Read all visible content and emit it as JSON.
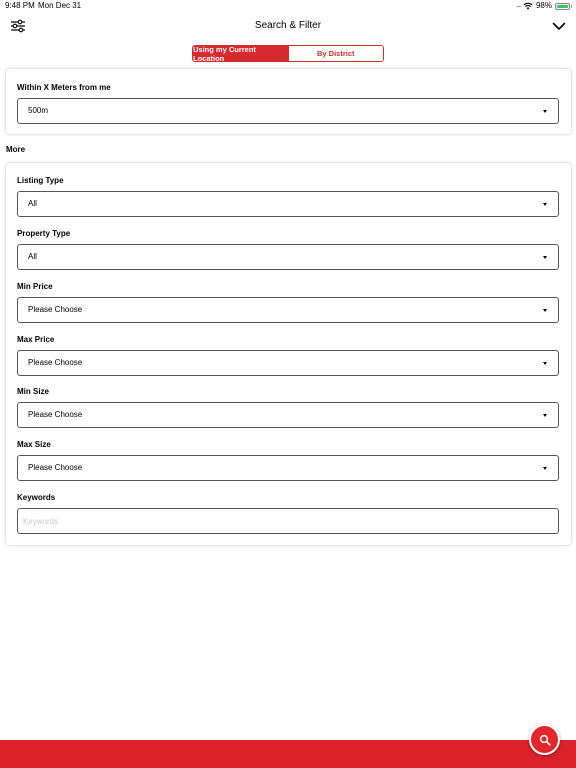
{
  "status_bar": {
    "time": "9:48 PM",
    "date": "Mon Dec 31",
    "signal_dots": "....",
    "battery": "98%",
    "battery_level": 0.98
  },
  "header": {
    "title": "Search & Filter",
    "left_icon": "filter-sliders-icon",
    "right_icon": "chevron-down-icon"
  },
  "segment": {
    "options": [
      "Using my Current Location",
      "By District"
    ],
    "selected": "Using my Current Location"
  },
  "location": {
    "label": "Within X Meters from me",
    "value": "500m"
  },
  "more": {
    "heading": "More",
    "listing_type": {
      "label": "Listing Type",
      "value": "All"
    },
    "property_type": {
      "label": "Property Type",
      "value": "All"
    },
    "min_price": {
      "label": "Min Price",
      "value": "Please Choose"
    },
    "max_price": {
      "label": "Max Price",
      "value": "Please Choose"
    },
    "min_size": {
      "label": "Min Size",
      "value": "Please Choose"
    },
    "max_size": {
      "label": "Max Size",
      "value": "Please Choose"
    },
    "keywords": {
      "label": "Keywords",
      "placeholder": "Keywords",
      "value": ""
    }
  },
  "fab": {
    "icon": "search-icon"
  },
  "colors": {
    "accent": "#d52b2f",
    "bottom_bar": "#dc2128",
    "battery_green": "#35c759"
  }
}
